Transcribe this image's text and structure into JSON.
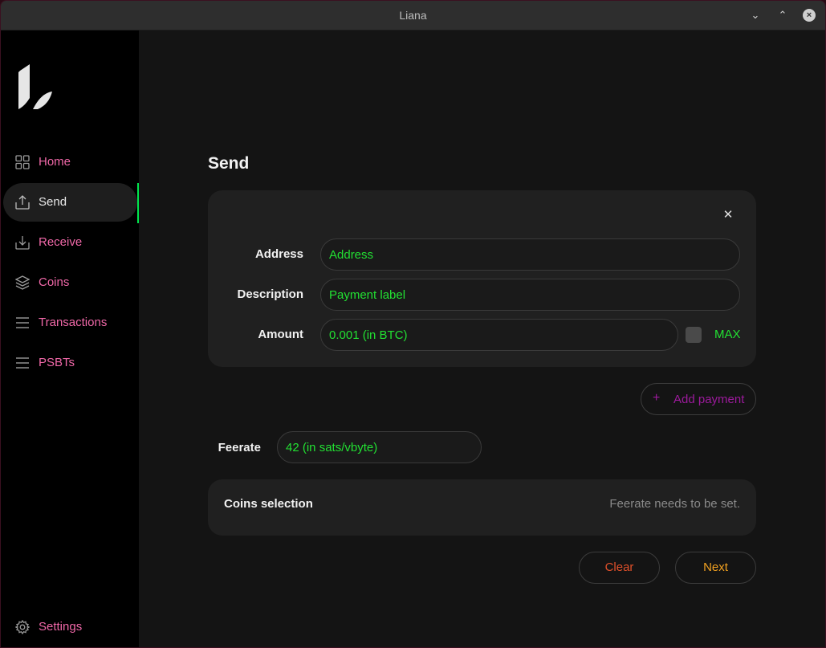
{
  "window": {
    "title": "Liana"
  },
  "sidebar": {
    "items": [
      {
        "label": "Home",
        "icon": "grid-icon"
      },
      {
        "label": "Send",
        "icon": "send-icon"
      },
      {
        "label": "Receive",
        "icon": "receive-icon"
      },
      {
        "label": "Coins",
        "icon": "layers-icon"
      },
      {
        "label": "Transactions",
        "icon": "list-icon"
      },
      {
        "label": "PSBTs",
        "icon": "list-icon"
      }
    ],
    "active": "Send",
    "settings_label": "Settings"
  },
  "main": {
    "page_title": "Send",
    "payment": {
      "address_label": "Address",
      "address_placeholder": "Address",
      "description_label": "Description",
      "description_placeholder": "Payment label",
      "amount_label": "Amount",
      "amount_value": "0.001 (in BTC)",
      "max_label": "MAX"
    },
    "add_payment_label": "Add payment",
    "feerate_label": "Feerate",
    "feerate_value": "42 (in sats/vbyte)",
    "coins_selection_title": "Coins selection",
    "coins_selection_message": "Feerate needs to be set.",
    "clear_label": "Clear",
    "next_label": "Next"
  },
  "colors": {
    "accent_pink": "#f068a8",
    "input_green": "#22e032",
    "active_green": "#00e64d",
    "add_purple": "#9c1a9c",
    "clear_orange": "#e0502a",
    "next_orange": "#f0a020"
  }
}
